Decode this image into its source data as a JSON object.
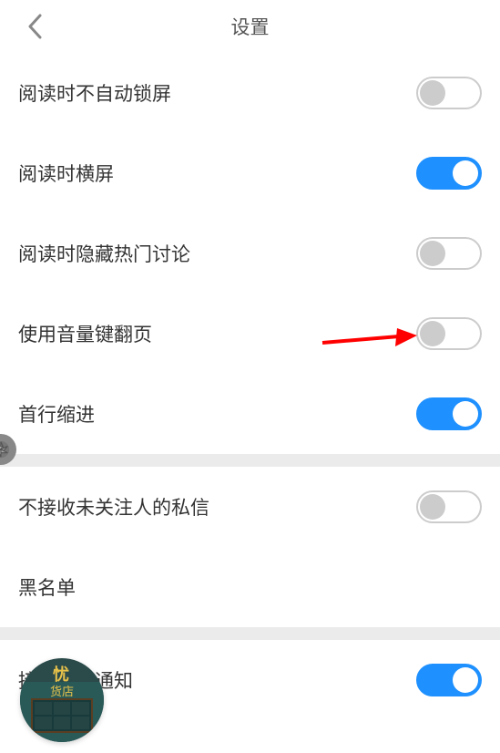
{
  "header": {
    "title": "设置"
  },
  "settings": {
    "auto_lock": {
      "label": "阅读时不自动锁屏",
      "on": false
    },
    "landscape": {
      "label": "阅读时横屏",
      "on": true
    },
    "hide_discussion": {
      "label": "阅读时隐藏热门讨论",
      "on": false
    },
    "volume_page": {
      "label": "使用音量键翻页",
      "on": false
    },
    "indent": {
      "label": "首行缩进",
      "on": true
    },
    "no_dm": {
      "label": "不接收未关注人的私信",
      "on": false
    },
    "blacklist": {
      "label": "黑名单"
    },
    "push": {
      "label": "接收推送通知",
      "on": true
    }
  },
  "book_overlay": {
    "title_top": "忧",
    "title_sub": "货店"
  },
  "colors": {
    "accent": "#1e90ff",
    "arrow": "#ff0000"
  }
}
